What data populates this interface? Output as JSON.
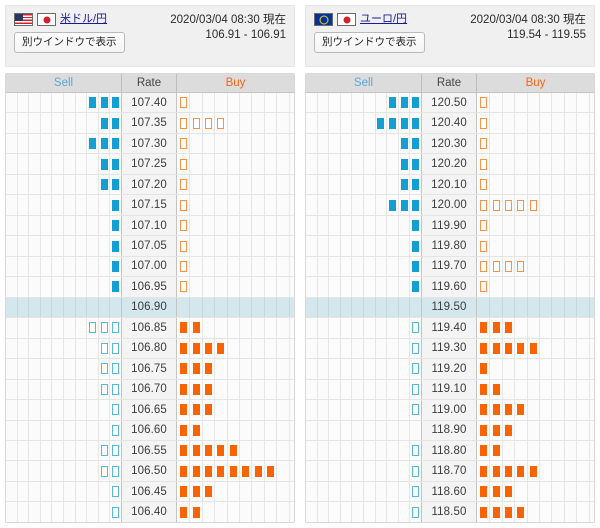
{
  "table": {
    "headers": {
      "sell": "Sell",
      "rate": "Rate",
      "buy": "Buy"
    },
    "columns": 10,
    "accent_blue": "#139ed4",
    "accent_blue_hollow": "#56b6e4",
    "accent_orange": "#fa6400",
    "accent_orange_hollow": "#f99149",
    "mid_row_bg": "#d4e7ed"
  },
  "panels": [
    {
      "id": "usdjpy",
      "pair_label": "米ドル/円",
      "flags": [
        "us-flag-icon",
        "jp-flag-icon"
      ],
      "window_button_label": "別ウインドウで表示",
      "timestamp": "2020/03/04 08:30 現在",
      "spread": "106.91 - 106.91",
      "rows": [
        {
          "rate": "107.40",
          "sell": 3,
          "buy": 1,
          "side": "upper"
        },
        {
          "rate": "107.35",
          "sell": 2,
          "buy": 4,
          "side": "upper"
        },
        {
          "rate": "107.30",
          "sell": 3,
          "buy": 1,
          "side": "upper"
        },
        {
          "rate": "107.25",
          "sell": 2,
          "buy": 1,
          "side": "upper"
        },
        {
          "rate": "107.20",
          "sell": 2,
          "buy": 1,
          "side": "upper"
        },
        {
          "rate": "107.15",
          "sell": 1,
          "buy": 1,
          "side": "upper"
        },
        {
          "rate": "107.10",
          "sell": 1,
          "buy": 1,
          "side": "upper"
        },
        {
          "rate": "107.05",
          "sell": 1,
          "buy": 1,
          "side": "upper"
        },
        {
          "rate": "107.00",
          "sell": 1,
          "buy": 1,
          "side": "upper"
        },
        {
          "rate": "106.95",
          "sell": 1,
          "buy": 1,
          "side": "upper"
        },
        {
          "rate": "106.90",
          "sell": 0,
          "buy": 0,
          "side": "mid"
        },
        {
          "rate": "106.85",
          "sell": 3,
          "buy": 2,
          "side": "lower"
        },
        {
          "rate": "106.80",
          "sell": 2,
          "buy": 4,
          "side": "lower"
        },
        {
          "rate": "106.75",
          "sell": 2,
          "buy": 3,
          "side": "lower"
        },
        {
          "rate": "106.70",
          "sell": 2,
          "buy": 3,
          "side": "lower"
        },
        {
          "rate": "106.65",
          "sell": 1,
          "buy": 3,
          "side": "lower"
        },
        {
          "rate": "106.60",
          "sell": 1,
          "buy": 2,
          "side": "lower"
        },
        {
          "rate": "106.55",
          "sell": 2,
          "buy": 5,
          "side": "lower"
        },
        {
          "rate": "106.50",
          "sell": 2,
          "buy": 8,
          "side": "lower"
        },
        {
          "rate": "106.45",
          "sell": 1,
          "buy": 3,
          "side": "lower"
        },
        {
          "rate": "106.40",
          "sell": 1,
          "buy": 2,
          "side": "lower"
        }
      ]
    },
    {
      "id": "eurjpy",
      "pair_label": "ユーロ/円",
      "flags": [
        "eu-flag-icon",
        "jp-flag-icon"
      ],
      "window_button_label": "別ウインドウで表示",
      "timestamp": "2020/03/04 08:30 現在",
      "spread": "119.54 - 119.55",
      "rows": [
        {
          "rate": "120.50",
          "sell": 3,
          "buy": 1,
          "side": "upper"
        },
        {
          "rate": "120.40",
          "sell": 4,
          "buy": 1,
          "side": "upper"
        },
        {
          "rate": "120.30",
          "sell": 2,
          "buy": 1,
          "side": "upper"
        },
        {
          "rate": "120.20",
          "sell": 2,
          "buy": 1,
          "side": "upper"
        },
        {
          "rate": "120.10",
          "sell": 2,
          "buy": 1,
          "side": "upper"
        },
        {
          "rate": "120.00",
          "sell": 3,
          "buy": 5,
          "side": "upper"
        },
        {
          "rate": "119.90",
          "sell": 1,
          "buy": 1,
          "side": "upper"
        },
        {
          "rate": "119.80",
          "sell": 1,
          "buy": 1,
          "side": "upper"
        },
        {
          "rate": "119.70",
          "sell": 1,
          "buy": 4,
          "side": "upper"
        },
        {
          "rate": "119.60",
          "sell": 1,
          "buy": 1,
          "side": "upper"
        },
        {
          "rate": "119.50",
          "sell": 0,
          "buy": 0,
          "side": "mid"
        },
        {
          "rate": "119.40",
          "sell": 1,
          "buy": 3,
          "side": "lower"
        },
        {
          "rate": "119.30",
          "sell": 1,
          "buy": 5,
          "side": "lower"
        },
        {
          "rate": "119.20",
          "sell": 1,
          "buy": 1,
          "side": "lower"
        },
        {
          "rate": "119.10",
          "sell": 1,
          "buy": 2,
          "side": "lower"
        },
        {
          "rate": "119.00",
          "sell": 1,
          "buy": 4,
          "side": "lower"
        },
        {
          "rate": "118.90",
          "sell": 0,
          "buy": 3,
          "side": "lower"
        },
        {
          "rate": "118.80",
          "sell": 1,
          "buy": 2,
          "side": "lower"
        },
        {
          "rate": "118.70",
          "sell": 1,
          "buy": 5,
          "side": "lower"
        },
        {
          "rate": "118.60",
          "sell": 1,
          "buy": 3,
          "side": "lower"
        },
        {
          "rate": "118.50",
          "sell": 1,
          "buy": 4,
          "side": "lower"
        }
      ]
    }
  ]
}
